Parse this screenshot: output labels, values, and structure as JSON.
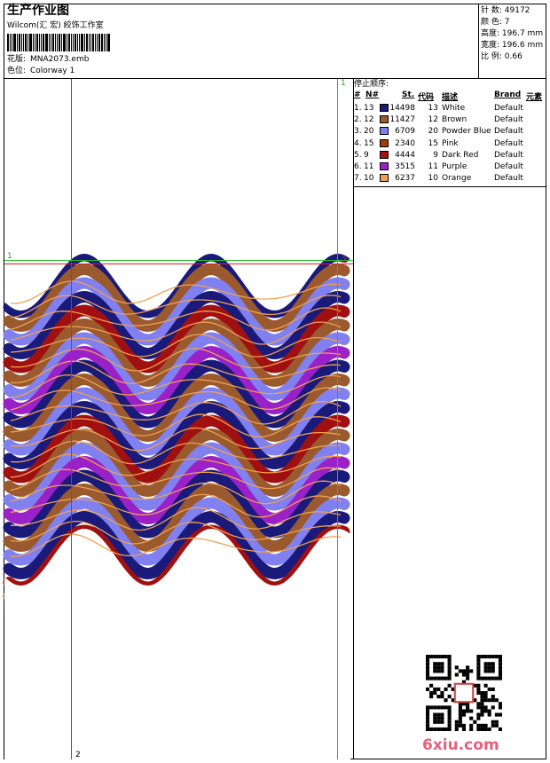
{
  "header": {
    "title": "生产作业图",
    "company": "Wilcom(汇 宏) 絞饰工作室",
    "design_label": "花版:",
    "design_value": "MNA2073.emb",
    "colorway_label": "色位:",
    "colorway_value": "Colorway 1"
  },
  "stats": [
    {
      "label": "针 数:",
      "value": "49172"
    },
    {
      "label": "颜 色:",
      "value": "7"
    },
    {
      "label": "高度:",
      "value": "196.7 mm"
    },
    {
      "label": "宽度:",
      "value": "196.6 mm"
    },
    {
      "label": "比 例:",
      "value": "0.66"
    }
  ],
  "stop_sequence": {
    "title": "停止顺序:",
    "columns": [
      "#",
      "N#",
      "St.",
      "代码",
      "描述",
      "Brand",
      "元素"
    ],
    "rows": [
      {
        "no": "1.",
        "n": "13",
        "color": "#1a1a7a",
        "st": "14498",
        "code": "13",
        "desc": "White",
        "brand": "Default"
      },
      {
        "no": "2.",
        "n": "12",
        "color": "#9a5a2e",
        "st": "11427",
        "code": "12",
        "desc": "Brown",
        "brand": "Default"
      },
      {
        "no": "3.",
        "n": "20",
        "color": "#8080f0",
        "st": "6709",
        "code": "20",
        "desc": "Powder Blue",
        "brand": "Default"
      },
      {
        "no": "4.",
        "n": "15",
        "color": "#a03c10",
        "st": "2340",
        "code": "15",
        "desc": "Pink",
        "brand": "Default"
      },
      {
        "no": "5.",
        "n": "9",
        "color": "#a01010",
        "st": "4444",
        "code": "9",
        "desc": "Dark Red",
        "brand": "Default"
      },
      {
        "no": "6.",
        "n": "11",
        "color": "#9a20c8",
        "st": "3515",
        "code": "11",
        "desc": "Purple",
        "brand": "Default"
      },
      {
        "no": "7.",
        "n": "10",
        "color": "#f0a050",
        "st": "6237",
        "code": "10",
        "desc": "Orange",
        "brand": "Default"
      }
    ]
  },
  "guides": {
    "top_label_1": "1",
    "right_label_1": "1",
    "right_label_2": "2",
    "bottom_label_2": "2"
  },
  "watermark": "6xiu.com",
  "colors": {
    "guide_red": "#e02020",
    "guide_green": "#20c020"
  }
}
